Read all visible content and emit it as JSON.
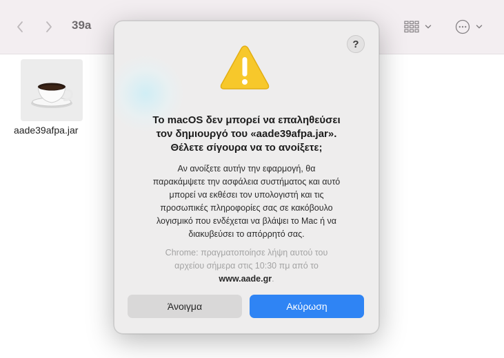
{
  "finder": {
    "back_icon": "chevron-left-icon",
    "forward_icon": "chevron-right-icon",
    "folder_title": "39a",
    "view_icon": "icon-grid-icon",
    "more_icon": "ellipsis-circle-icon",
    "file": {
      "name": "aade39afpa.jar",
      "icon": "java-coffee-cup-icon"
    }
  },
  "dialog": {
    "help_label": "?",
    "warning_icon": "warning-triangle-icon",
    "heading_lines": [
      "Το macOS δεν μπορεί να επαληθεύσει",
      "τον δημιουργό του «aade39afpa.jar».",
      "Θέλετε σίγουρα να το ανοίξετε;"
    ],
    "body_lines": [
      "Αν ανοίξετε αυτήν την εφαρμογή, θα",
      "παρακάμψετε την ασφάλεια συστήματος και αυτό",
      "μπορεί να εκθέσει τον υπολογιστή και τις",
      "προσωπικές πληροφορίες σας σε κακόβουλο",
      "λογισμικό που ενδέχεται να βλάψει το Mac ή να",
      "διακυβεύσει το απόρρητό σας."
    ],
    "source_lines": [
      "Chrome: πραγματοποίησε λήψη αυτού του",
      "αρχείου σήμερα στις 10:30 πμ από το"
    ],
    "source_domain": "www.aade.gr",
    "source_suffix": ".",
    "open_button": "Άνοιγμα",
    "cancel_button": "Ακύρωση"
  },
  "colors": {
    "accent": "#2f84f4",
    "warning_yellow": "#f7c82b",
    "toolbar_bg": "#f3eef1",
    "dialog_bg": "#eeeded"
  }
}
